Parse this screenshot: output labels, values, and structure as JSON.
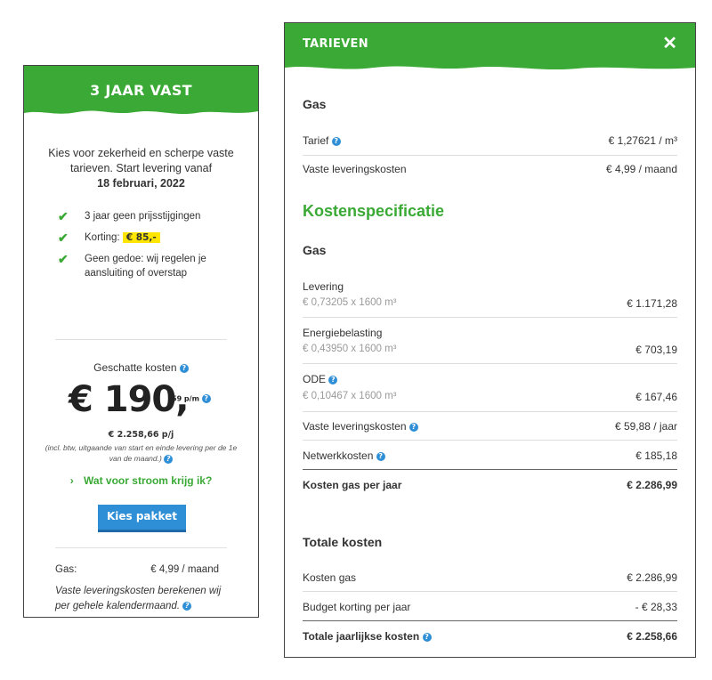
{
  "colors": {
    "brand_green": "#3aa935",
    "info_blue": "#2f8fd6",
    "badge_yellow": "#ffe600"
  },
  "card": {
    "title": "3 JAAR VAST",
    "intro": "Kies voor zekerheid en scherpe vaste tarieven. Start levering vanaf",
    "start_date": "18 februari, 2022",
    "features": [
      {
        "text": "3 jaar geen prijsstijgingen"
      },
      {
        "text": "Korting:",
        "badge": "€ 85,-"
      },
      {
        "text": "Geen gedoe: wij regelen je aansluiting of overstap"
      }
    ],
    "estimated_label": "Geschatte kosten",
    "price_main": "€ 190,",
    "price_sub": "59 p/m",
    "price_year": "€ 2.258,66 p/j",
    "fineprint": "(incl. btw, uitgaande van start en einde levering per de 1e van de maand.)",
    "link": "Wat voor stroom krijg ik?",
    "button": "Kies pakket",
    "gas_label": "Gas:",
    "gas_value": "€ 4,99 / maand",
    "note": "Vaste leveringskosten berekenen wij per gehele kalendermaand."
  },
  "modal": {
    "title": "TARIEVEN",
    "close_icon": "close-icon",
    "gas_heading": "Gas",
    "tarief_label": "Tarief",
    "tarief_value": "€ 1,27621 / m³",
    "vast_label": "Vaste leveringskosten",
    "vast_value": "€ 4,99 / maand",
    "spec_heading": "Kostenspecificatie",
    "spec_gas_heading": "Gas",
    "levering_label": "Levering",
    "levering_calc": "€ 0,73205 x 1600 m³",
    "levering_value": "€ 1.171,28",
    "energie_label": "Energiebelasting",
    "energie_calc": "€ 0,43950 x 1600 m³",
    "energie_value": "€ 703,19",
    "ode_label": "ODE",
    "ode_calc": "€ 0,10467 x 1600 m³",
    "ode_value": "€ 167,46",
    "vast_year_label": "Vaste leveringskosten",
    "vast_year_value": "€ 59,88 / jaar",
    "netwerk_label": "Netwerkkosten",
    "netwerk_value": "€ 185,18",
    "kosten_gas_jaar_label": "Kosten gas per jaar",
    "kosten_gas_jaar_value": "€ 2.286,99",
    "totale_heading": "Totale kosten",
    "kosten_gas_label": "Kosten gas",
    "kosten_gas_value": "€ 2.286,99",
    "budget_label": "Budget korting per jaar",
    "budget_value": "- € 28,33",
    "totaal_label": "Totale jaarlijkse kosten",
    "totaal_value": "€ 2.258,66"
  }
}
